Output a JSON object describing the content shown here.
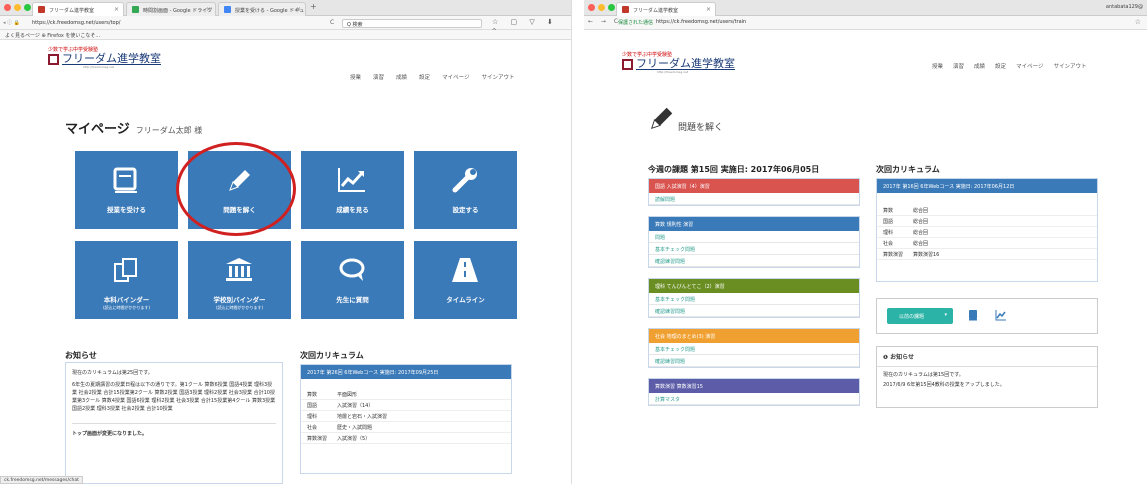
{
  "left": {
    "tabs": [
      {
        "label": "フリーダム進学教室",
        "color": "#c0392b"
      },
      {
        "label": "時間割画面 - Google ドライブ",
        "color": "#4285f4"
      },
      {
        "label": "授業を受ける - Google ドキュ",
        "color": "#4285f4"
      }
    ],
    "url": "https://ck.freedomsg.net/users/top/",
    "search_placeholder": "Q 検索",
    "bookmarks": "よく見るページ ⊕ Firefox を使いこなそ...",
    "logo_small": "少数で学ぶ中学受験塾",
    "logo_name": "フリーダム進学教室",
    "logo_url": "http://freedomsg.net",
    "nav": [
      "授業",
      "演習",
      "成績",
      "設定",
      "マイページ",
      "サインアウト"
    ],
    "page_title": "マイページ",
    "user_name": "フリーダム太郎 様",
    "tiles": [
      {
        "label": "授業を受ける",
        "sub": "",
        "icon": "book-icon"
      },
      {
        "label": "問題を解く",
        "sub": "",
        "icon": "pencil-icon"
      },
      {
        "label": "成績を見る",
        "sub": "",
        "icon": "chart-icon"
      },
      {
        "label": "設定する",
        "sub": "",
        "icon": "wrench-icon"
      },
      {
        "label": "本科バインダー",
        "sub": "(読込に時間がかかります)",
        "icon": "copy-icon"
      },
      {
        "label": "学校別バインダー",
        "sub": "(読込に時間がかかります)",
        "icon": "bank-icon"
      },
      {
        "label": "先生に質問",
        "sub": "",
        "icon": "chat-icon"
      },
      {
        "label": "タイムライン",
        "sub": "",
        "icon": "road-icon"
      }
    ],
    "news_title": "お知らせ",
    "news_lines": [
      "現在のカリキュラムは第25回です。",
      "6年生の夏期講習の授業日程は以下の通りです。第1クール 算数6授業 国語4授業 理科3授業 社会2授業 合計15授業第2クール 算数2授業 国語3授業 理科2授業 社会3授業 合計10授業第3クール 算数4授業 国語6授業 理科2授業 社会3授業 合計15授業第4クール 算数3授業 国語2授業 理科3授業 社会2授業 合計10授業"
    ],
    "news_footer": "トップ画面が変更になりました。",
    "curr_title": "次回カリキュラム",
    "curr_header": "2017年 第26回 6年Webコース 実施日: 2017年09月25日",
    "curr_rows": [
      {
        "k": "算数",
        "v": "平面図形"
      },
      {
        "k": "国語",
        "v": "入試演習（14）"
      },
      {
        "k": "理科",
        "v": "地層と岩石・入試演習"
      },
      {
        "k": "社会",
        "v": "歴史・入試問題"
      },
      {
        "k": "算数演習",
        "v": "入試演習（5）"
      }
    ],
    "status_url": "ck.freedomsg.net/messages/chat"
  },
  "right": {
    "tab": "フリーダム進学教室",
    "secure": "保護された通信",
    "url": "https://ck.freedomsg.net/users/train",
    "user_corner": "antabata129@",
    "logo_small": "少数で学ぶ中学受験塾",
    "logo_name": "フリーダム進学教室",
    "logo_url": "http://freedomsg.net",
    "nav": [
      "授業",
      "演習",
      "成績",
      "設定",
      "マイページ",
      "サインアウト"
    ],
    "page_title": "問題を解く",
    "weekly_title": "今週の課題 第15回 実施日: 2017年06月05日",
    "groups": [
      {
        "head": "国語 入試演習（4）演習",
        "color": "red",
        "rows": [
          "読解問題"
        ]
      },
      {
        "head": "算数 規則性 演習",
        "color": "blue",
        "rows": [
          "問題",
          "基本チェック問題",
          "確認練習問題"
        ]
      },
      {
        "head": "理科 てんびんとてこ（2）演習",
        "color": "green",
        "rows": [
          "基本チェック問題",
          "確認練習問題"
        ]
      },
      {
        "head": "社会 地理のまとめ(3) 演習",
        "color": "orange",
        "rows": [
          "基本チェック問題",
          "確認練習問題"
        ]
      },
      {
        "head": "算数演習 算数演習15",
        "color": "purple",
        "rows": [
          "計算マスタ"
        ]
      }
    ],
    "curr_title": "次回カリキュラム",
    "curr_header": "2017年 第16回 6年Webコース 実施日: 2017年06月12日",
    "curr_rows": [
      {
        "k": "算数",
        "v": "総合回"
      },
      {
        "k": "国語",
        "v": "総合回"
      },
      {
        "k": "理科",
        "v": "総合回"
      },
      {
        "k": "社会",
        "v": "総合回"
      },
      {
        "k": "算数演習",
        "v": "算数演習16"
      }
    ],
    "past_button": "以前の課題",
    "news_title": "お知らせ",
    "news_lines": [
      "現在のカリキュラムは第15回です。",
      "2017/6/9 6年第15回4教科の授業をアップしました。"
    ]
  },
  "colors": {
    "tile": "#3b7ab8",
    "circle": "#d02020",
    "teal": "#2ab3a6"
  }
}
